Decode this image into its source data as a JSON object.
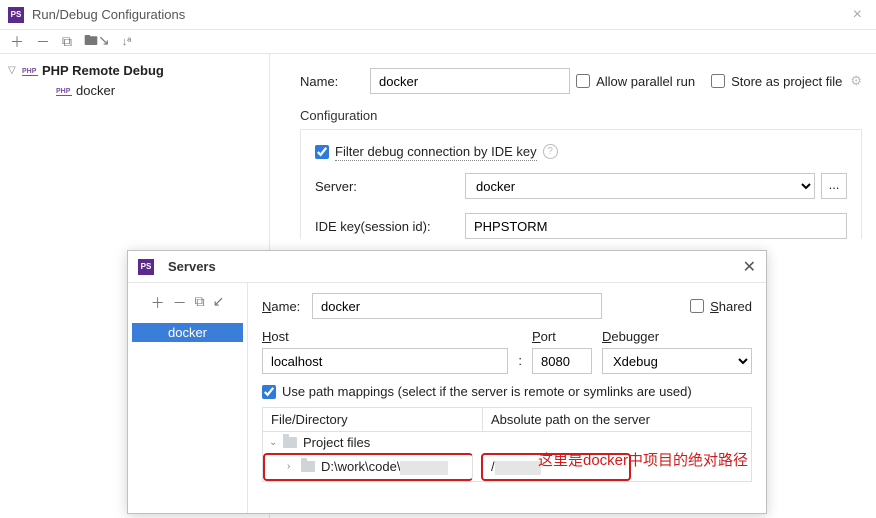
{
  "window": {
    "title": "Run/Debug Configurations"
  },
  "tree": {
    "root": "PHP Remote Debug",
    "child": "docker"
  },
  "form": {
    "nameLabel": "Name:",
    "nameValue": "docker",
    "allowParallel": "Allow parallel run",
    "storeAsFile": "Store as project file"
  },
  "config": {
    "sectionTitle": "Configuration",
    "filterLabel": "Filter debug connection by IDE key",
    "serverLabel": "Server:",
    "serverValue": "docker",
    "ideKeyLabel": "IDE key(session id):",
    "ideKeyValue": "PHPSTORM",
    "dotsBtn": "..."
  },
  "servers": {
    "dialogTitle": "Servers",
    "selected": "docker",
    "nameLabel": "Name:",
    "nameValue": "docker",
    "sharedLabel": "Shared",
    "hostLabel": "Host",
    "hostValue": "localhost",
    "colon": ":",
    "portLabel": "Port",
    "portValue": "8080",
    "debuggerLabel": "Debugger",
    "debuggerValue": "Xdebug",
    "usePathLabel": "Use path mappings (select if the server is remote or symlinks are used)",
    "colFile": "File/Directory",
    "colAbs": "Absolute path on the server",
    "projectFiles": "Project files",
    "projectPath": "D:\\work\\code\\",
    "absPath": "/"
  },
  "annotation": "这里是docker中项目的绝对路径",
  "sharedLetter": "S",
  "sharedRest": "hared",
  "hostLetter": "H",
  "hostRest": "ost",
  "portLetter": "P",
  "portRest": "ort",
  "debuggerLetter": "D",
  "debuggerRest": "ebugger"
}
